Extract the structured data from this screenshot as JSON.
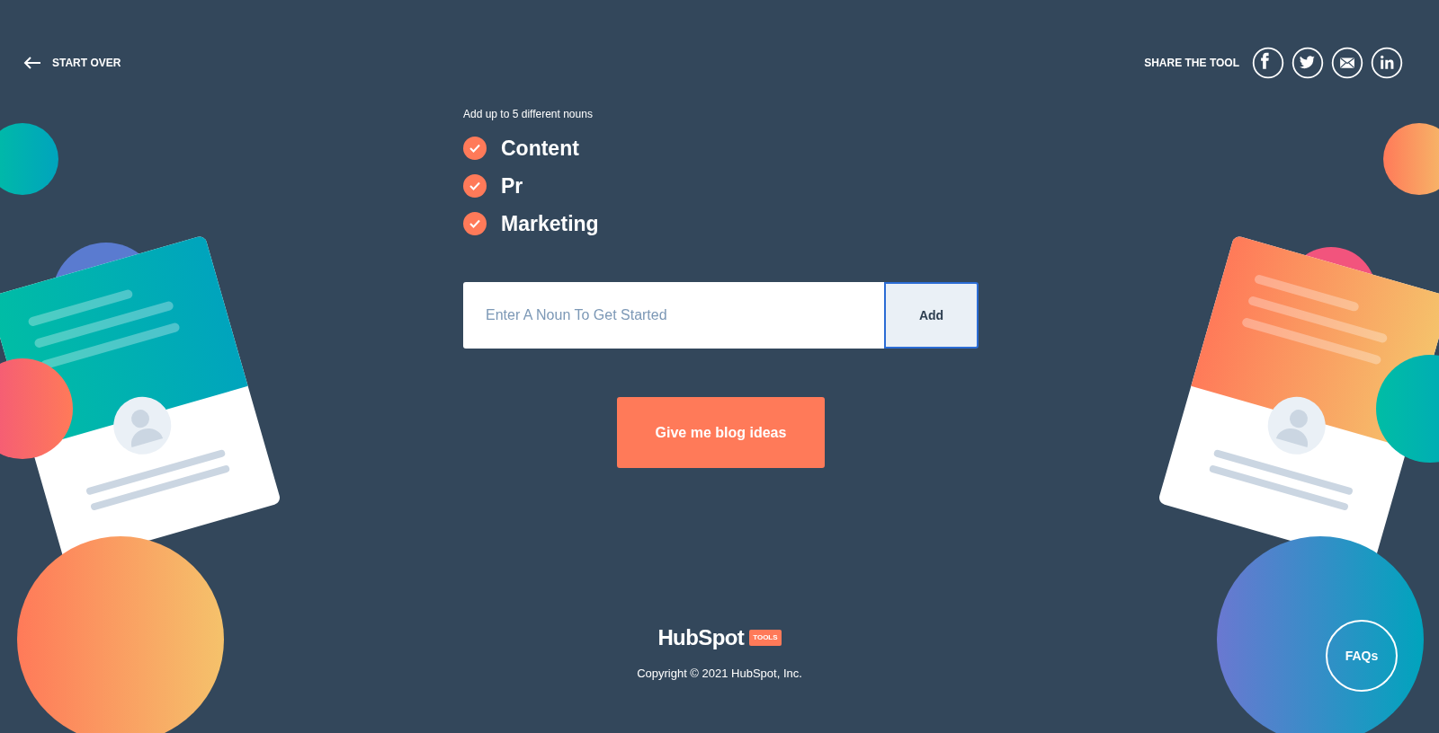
{
  "header": {
    "back_link": "START OVER",
    "share_label": "SHARE THE TOOL",
    "share_icons": [
      {
        "kind": "facebook"
      },
      {
        "kind": "twitter"
      },
      {
        "kind": "email"
      },
      {
        "kind": "linkedin"
      }
    ]
  },
  "nouns": {
    "hint": "Add up to 5 different nouns",
    "items": [
      {
        "label": "Content",
        "checked": true
      },
      {
        "label": "Pr",
        "checked": true
      },
      {
        "label": "Marketing",
        "checked": true
      }
    ]
  },
  "input": {
    "placeholder": "Enter A Noun To Get Started",
    "button": "Add"
  },
  "submit_button": "Give me blog ideas",
  "footer": {
    "logo": "HubSpot",
    "badge": "TOOLS",
    "copyright": "Copyright © 2021 HubSpot, Inc."
  },
  "faq_button": "FAQs"
}
